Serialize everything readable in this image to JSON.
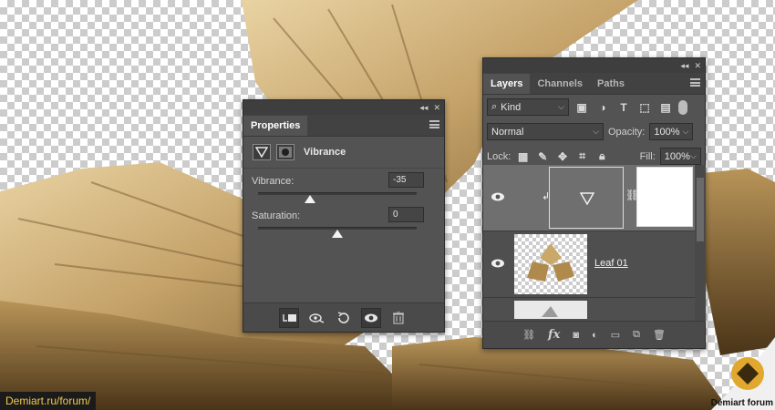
{
  "properties": {
    "tab": "Properties",
    "adjustment_name": "Vibrance",
    "vibrance_label": "Vibrance:",
    "vibrance_value": "-35",
    "vibrance_level": -35,
    "saturation_label": "Saturation:",
    "saturation_value": "0",
    "saturation_level": 0
  },
  "layers": {
    "tabs": [
      "Layers",
      "Channels",
      "Paths"
    ],
    "filter_label": "Kind",
    "blend_mode": "Normal",
    "opacity_label": "Opacity:",
    "opacity_value": "100%",
    "lock_label": "Lock:",
    "fill_label": "Fill:",
    "fill_value": "100%",
    "items": [
      {
        "name": "",
        "type": "vibrance-adjustment",
        "selected": true
      },
      {
        "name": "Leaf 01",
        "type": "image",
        "selected": false
      },
      {
        "name": "",
        "type": "image",
        "selected": false
      }
    ]
  },
  "watermark": {
    "url": "Demiart.ru/forum/",
    "badge_text": "Demiart forum"
  },
  "colors": {
    "panel_bg": "#535353",
    "selected_row": "#6f6f6f",
    "leaf_gold": "#c9a86a"
  }
}
